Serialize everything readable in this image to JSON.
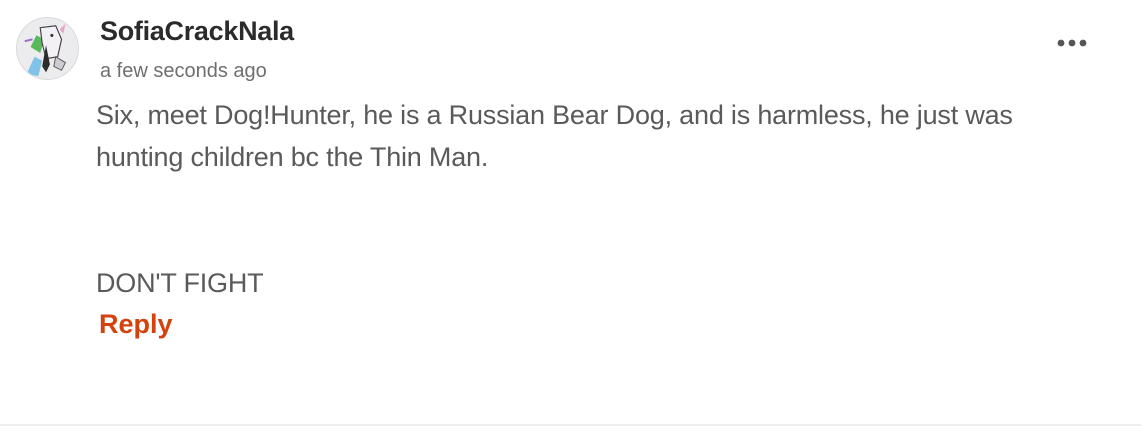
{
  "comment": {
    "username": "SofiaCrackNala",
    "timestamp": "a few seconds ago",
    "body_lines": [
      "Six, meet Dog!Hunter, he is a Russian Bear Dog, and is harmless, he just was hunting children bc the Thin Man.",
      "",
      "DON'T FIGHT"
    ],
    "reply_label": "Reply",
    "avatar_icon": "user-avatar-icon",
    "more_icon": "more-options-icon"
  },
  "colors": {
    "reply_accent": "#d4420e",
    "username_text": "#2b2b2b",
    "body_text": "#5a5a5a",
    "timestamp_text": "#6f6f6f"
  }
}
